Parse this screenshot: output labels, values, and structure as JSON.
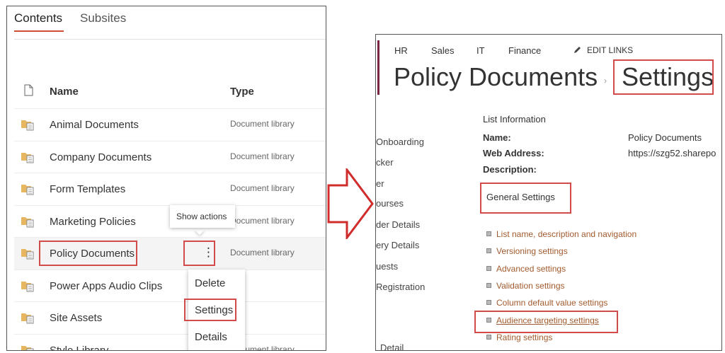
{
  "left": {
    "tabs": {
      "contents": "Contents",
      "subsites": "Subsites"
    },
    "columns": {
      "name": "Name",
      "type": "Type"
    },
    "rows": [
      {
        "name": "Animal Documents",
        "type": "Document library"
      },
      {
        "name": "Company Documents",
        "type": "Document library"
      },
      {
        "name": "Form Templates",
        "type": "Document library"
      },
      {
        "name": "Marketing Policies",
        "type": "Document library"
      },
      {
        "name": "Policy Documents",
        "type": "Document library"
      },
      {
        "name": "Power Apps Audio Clips",
        "type": ""
      },
      {
        "name": "Site Assets",
        "type": ""
      },
      {
        "name": "Style Library",
        "type": "Document library"
      }
    ],
    "tooltip": "Show actions",
    "more_glyph": "⋮",
    "menu": {
      "delete": "Delete",
      "settings": "Settings",
      "details": "Details"
    }
  },
  "right": {
    "nav": {
      "hr": "HR",
      "sales": "Sales",
      "it": "IT",
      "finance": "Finance",
      "edit_links": "EDIT LINKS"
    },
    "title": {
      "list": "Policy Documents",
      "separator": "›",
      "page": "Settings"
    },
    "sidebar": [
      "Onboarding",
      "cker",
      "er",
      "ourses",
      "der Details",
      "ery Details",
      "uests",
      "Registration",
      "Detail"
    ],
    "list_information": {
      "heading": "List Information",
      "name_label": "Name:",
      "name_value": "Policy Documents",
      "web_label": "Web Address:",
      "web_value": "https://szg52.sharepo",
      "desc_label": "Description:"
    },
    "general_settings": "General Settings",
    "settings_links": [
      "List name, description and navigation",
      "Versioning settings",
      "Advanced settings",
      "Validation settings",
      "Column default value settings",
      "Audience targeting settings",
      "Rating settings"
    ]
  },
  "colors": {
    "accent": "#d14d2f",
    "link": "#a25b2e",
    "highlight": "#d24a4a",
    "folder": "#e6b760"
  }
}
